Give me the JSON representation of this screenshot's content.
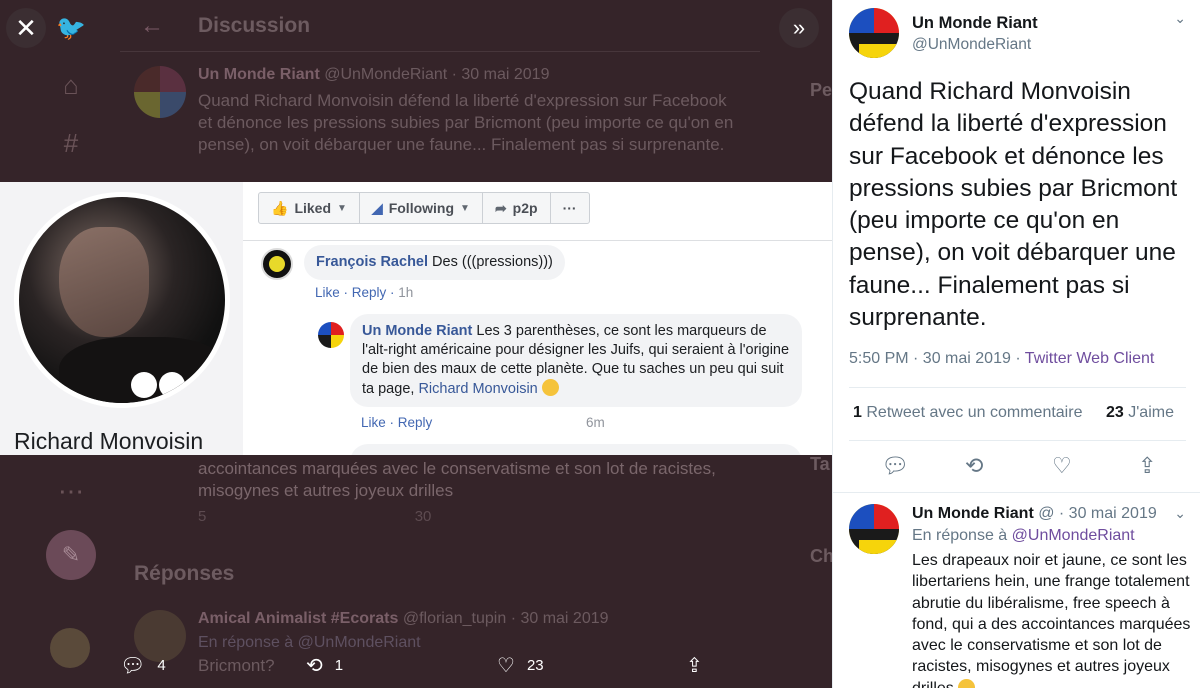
{
  "background": {
    "header_title": "Discussion",
    "tweet_author": "Un Monde Riant",
    "tweet_handle_date": "@UnMondeRiant · 30 mai 2019",
    "tweet_text": "Quand Richard Monvoisin défend la liberté d'expression sur Facebook et dénonce les pressions subies par Bricmont (peu importe ce qu'on en pense), on voit débarquer une faune... Finalement pas si surprenante.",
    "continuation_text": "accointances marquées avec le conservatisme et son lot de racistes, misogynes et autres joyeux drilles",
    "action_counts": [
      "5",
      "",
      "30"
    ],
    "replies_title": "Réponses",
    "reply_author": "Amical Animalist #Ecorats",
    "reply_handle_date": "@florian_tupin · 30 mai 2019",
    "reply_to": "En réponse à @UnMondeRiant",
    "reply_text": "Bricmont?",
    "right_fragments": [
      "Pe",
      "Ta",
      "Ch"
    ]
  },
  "media": {
    "profile_name": "Richard Monvoisin",
    "fb_buttons": [
      "Liked",
      "Following",
      "p2p",
      "···"
    ],
    "comment1": {
      "author": "François Rachel",
      "text": "Des (((pressions)))",
      "like": "Like",
      "reply": "Reply",
      "time": "1h"
    },
    "comment2": {
      "author": "Un Monde Riant",
      "text": "Les 3 parenthèses, ce sont les marqueurs de l'alt-right américaine pour désigner les Juifs, qui seraient à l'origine de bien des maux de cette planète. Que tu saches un peu qui suit ta page,",
      "mention": "Richard Monvoisin",
      "like": "Like",
      "reply": "Reply",
      "time": "6m"
    }
  },
  "media_actions": {
    "replies": "4",
    "retweets": "1",
    "likes": "23"
  },
  "tweet": {
    "author": "Un Monde Riant",
    "handle": "@UnMondeRiant",
    "text": "Quand Richard Monvoisin défend la liberté d'expression sur Facebook et dénonce les pressions subies par Bricmont (peu importe ce qu'on en pense), on voit débarquer une faune... Finalement pas si surprenante.",
    "time": "5:50 PM · 30 mai 2019 · ",
    "source": "Twitter Web Client",
    "retweet_count": "1",
    "retweet_label": "Retweet avec un commentaire",
    "like_count": "23",
    "like_label": "J'aime"
  },
  "reply": {
    "author": "Un Monde Riant",
    "handle_date": "@ · 30 mai 2019",
    "reply_prefix": "En réponse à",
    "reply_handle": "@UnMondeRiant",
    "text": "Les drapeaux noir et jaune, ce sont les libertariens hein, une frange totalement abrutie du libéralisme, free speech à fond, qui a des accointances marquées avec le conservatisme et son lot de racistes, misogynes et autres joyeux drilles"
  },
  "colors": {
    "link": "#385898",
    "twitter_link": "#6f4d9e",
    "overlay": "#352429"
  }
}
